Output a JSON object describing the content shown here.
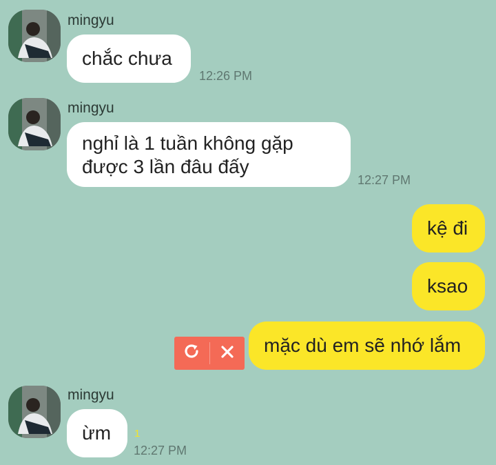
{
  "messages": [
    {
      "sender": "mingyu",
      "text": "chắc chưa",
      "time": "12:26 PM"
    },
    {
      "sender": "mingyu",
      "text_line1": "nghỉ là 1 tuần không gặp",
      "text_line2": "được 3 lần đâu đấy",
      "time": "12:27 PM"
    },
    {
      "text": "kệ đi"
    },
    {
      "text": "ksao"
    },
    {
      "text": "mặc dù em sẽ nhớ lắm",
      "retry_icon": "retry-icon",
      "delete_icon": "close-icon"
    },
    {
      "sender": "mingyu",
      "text": "ừm",
      "unread": "1",
      "time": "12:27 PM"
    }
  ],
  "colors": {
    "background": "#a4cdbf",
    "incoming": "#ffffff",
    "outgoing": "#fbe628",
    "retry": "#f46a56"
  }
}
